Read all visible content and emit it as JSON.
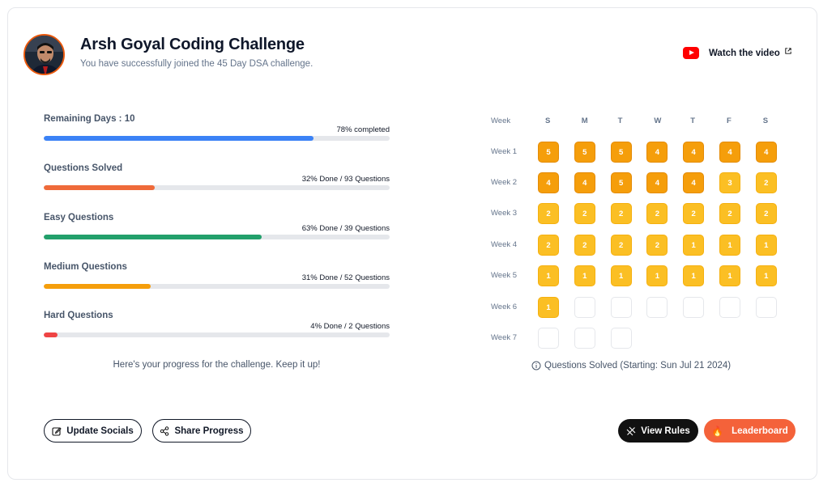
{
  "header": {
    "title": "Arsh Goyal Coding Challenge",
    "subtitle": "You have successfully joined the 45 Day DSA challenge.",
    "watch_label": "Watch the video",
    "icons": {
      "video": "youtube-icon",
      "external": "external-link-icon",
      "avatar": "avatar"
    }
  },
  "progress": [
    {
      "label": "Remaining Days : 10",
      "status": "78% completed",
      "percent": 78,
      "color": "#3b82f6"
    },
    {
      "label": "Questions Solved",
      "status": "32% Done / 93 Questions",
      "percent": 32,
      "color": "#ef6a3a"
    },
    {
      "label": "Easy Questions",
      "status": "63% Done / 39 Questions",
      "percent": 63,
      "color": "#22a06b"
    },
    {
      "label": "Medium Questions",
      "status": "31% Done / 52 Questions",
      "percent": 31,
      "color": "#f59e0b"
    },
    {
      "label": "Hard Questions",
      "status": "4% Done / 2 Questions",
      "percent": 4,
      "color": "#ef4444"
    }
  ],
  "encourage": "Here's your progress for the challenge. Keep it up!",
  "calendar": {
    "week_header": "Week",
    "days": [
      "S",
      "M",
      "T",
      "W",
      "T",
      "F",
      "S"
    ],
    "weeks": [
      {
        "label": "Week 1",
        "values": [
          "5",
          "5",
          "5",
          "4",
          "4",
          "4",
          "4"
        ]
      },
      {
        "label": "Week 2",
        "values": [
          "4",
          "4",
          "5",
          "4",
          "4",
          "3",
          "2"
        ]
      },
      {
        "label": "Week 3",
        "values": [
          "2",
          "2",
          "2",
          "2",
          "2",
          "2",
          "2"
        ]
      },
      {
        "label": "Week 4",
        "values": [
          "2",
          "2",
          "2",
          "2",
          "1",
          "1",
          "1"
        ]
      },
      {
        "label": "Week 5",
        "values": [
          "1",
          "1",
          "1",
          "1",
          "1",
          "1",
          "1"
        ]
      },
      {
        "label": "Week 6",
        "values": [
          "1",
          "",
          "",
          "",
          "",
          "",
          ""
        ]
      },
      {
        "label": "Week 7",
        "values": [
          "",
          "",
          ""
        ]
      }
    ],
    "colors": {
      "dark": "#f59e0b",
      "light": "#fbbf24"
    },
    "caption": "Questions Solved (Starting: Sun Jul 21 2024)"
  },
  "actions": {
    "update_socials": "Update Socials",
    "share_progress": "Share Progress",
    "view_rules": "View Rules",
    "leaderboard": "Leaderboard",
    "leaderboard_icon": "🔥"
  }
}
